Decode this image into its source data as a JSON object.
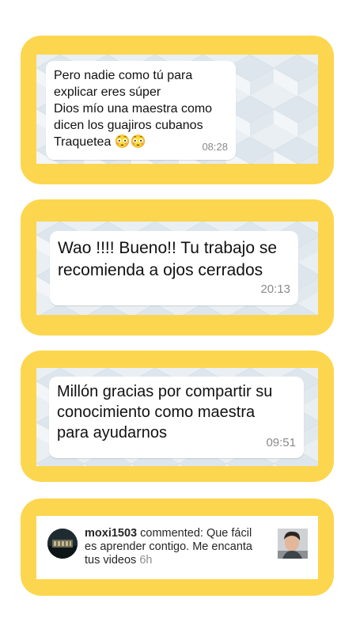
{
  "messages": [
    {
      "text": "Pero nadie como tú para\nexplicar eres súper\nDios mío una maestra como\ndicen los guajiros cubanos\nTraquetea 😳😳",
      "time": "08:28"
    },
    {
      "text": "Wao !!!! Bueno!! Tu trabajo se\nrecomienda a ojos cerrados",
      "time": "20:13"
    },
    {
      "text": "Millón gracias por compartir su\nconocimiento como maestra\npara ayudarnos",
      "time": "09:51"
    }
  ],
  "comment": {
    "username": "moxi1503",
    "text": " commented: Que fácil\nes aprender contigo. Me encanta\ntus videos ",
    "age": "6h",
    "avatar_icon": "avatar-icon",
    "thumbnail_icon": "video-thumbnail"
  },
  "colors": {
    "frame": "#fcd64e",
    "chat_bg": "#e9eff3",
    "bubble": "#ffffff",
    "time": "#8a8a8a"
  }
}
